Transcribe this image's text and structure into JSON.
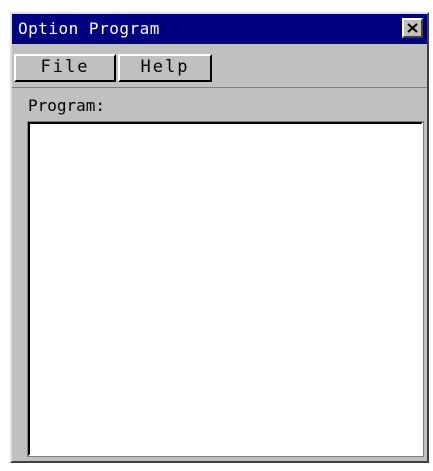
{
  "window": {
    "title": "Option Program"
  },
  "menubar": {
    "items": [
      {
        "label": "File"
      },
      {
        "label": "Help"
      }
    ]
  },
  "main": {
    "program_label": "Program:",
    "program_value": ""
  },
  "icons": {
    "close": "close-icon"
  },
  "colors": {
    "titlebar": "#000080",
    "titlebar_text": "#ffffff",
    "window_bg": "#c0c0c0",
    "field_bg": "#ffffff"
  }
}
